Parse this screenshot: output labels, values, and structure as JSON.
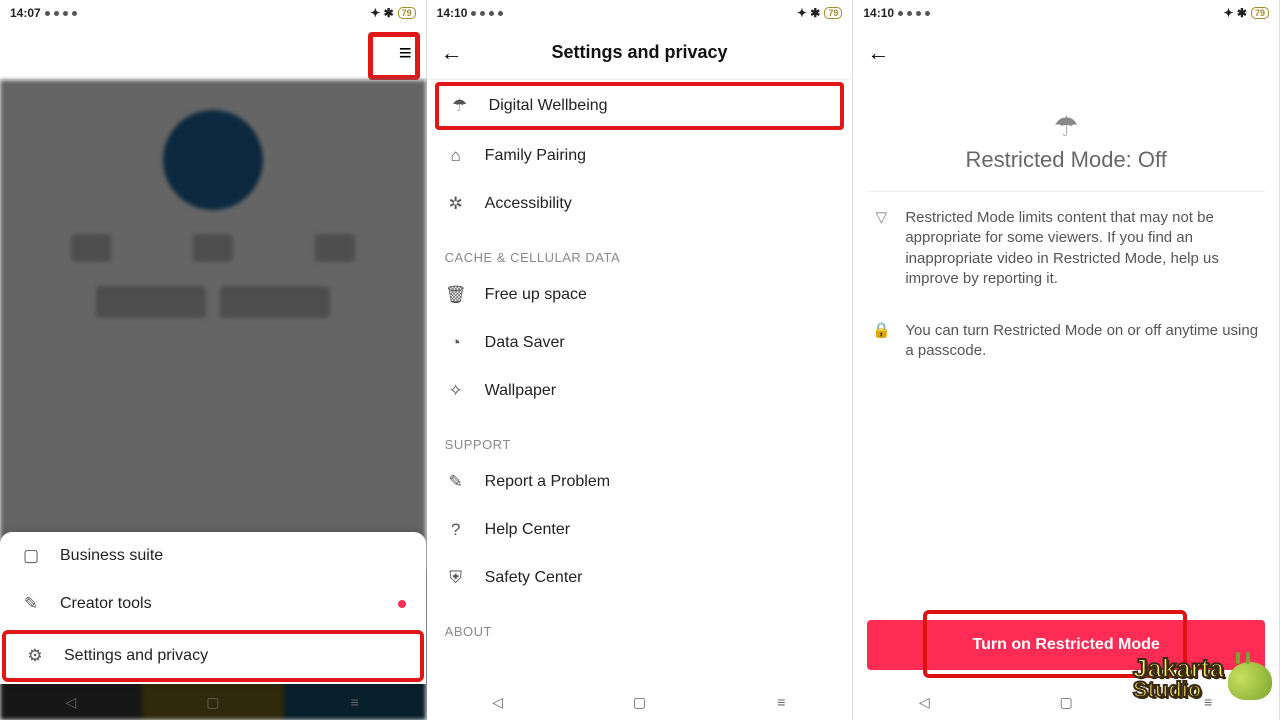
{
  "status": {
    "time1": "14:07",
    "time2": "14:10",
    "time3": "14:10",
    "batt": "79"
  },
  "panel1": {
    "menu": [
      {
        "icon": "storefront-icon",
        "label": "Business suite"
      },
      {
        "icon": "person-icon",
        "label": "Creator tools",
        "dot": true
      },
      {
        "icon": "gear-icon",
        "label": "Settings and privacy",
        "hl": true
      }
    ]
  },
  "panel2": {
    "title": "Settings and privacy",
    "groups": [
      {
        "items": [
          {
            "icon": "umbrella-icon",
            "label": "Digital Wellbeing",
            "hl": true
          },
          {
            "icon": "home-icon",
            "label": "Family Pairing"
          },
          {
            "icon": "person-circle-icon",
            "label": "Accessibility"
          }
        ]
      },
      {
        "header": "CACHE & CELLULAR DATA",
        "items": [
          {
            "icon": "trash-icon",
            "label": "Free up space"
          },
          {
            "icon": "drop-icon",
            "label": "Data Saver"
          },
          {
            "icon": "sparkle-icon",
            "label": "Wallpaper"
          }
        ]
      },
      {
        "header": "SUPPORT",
        "items": [
          {
            "icon": "pen-icon",
            "label": "Report a Problem"
          },
          {
            "icon": "question-icon",
            "label": "Help Center"
          },
          {
            "icon": "shield-icon",
            "label": "Safety Center"
          }
        ]
      },
      {
        "header": "ABOUT",
        "items": []
      }
    ]
  },
  "panel3": {
    "title": "Restricted Mode: Off",
    "rows": [
      {
        "icon": "filter-icon",
        "text": "Restricted Mode limits content that may not be appropriate for some viewers. If you find an inappropriate video in Restricted Mode, help us improve by reporting it."
      },
      {
        "icon": "lock-icon",
        "text": "You can turn Restricted Mode on or off anytime using a passcode."
      }
    ],
    "cta": "Turn on Restricted Mode"
  },
  "watermark": {
    "line1": "Jakarta",
    "line2": "Studio"
  }
}
